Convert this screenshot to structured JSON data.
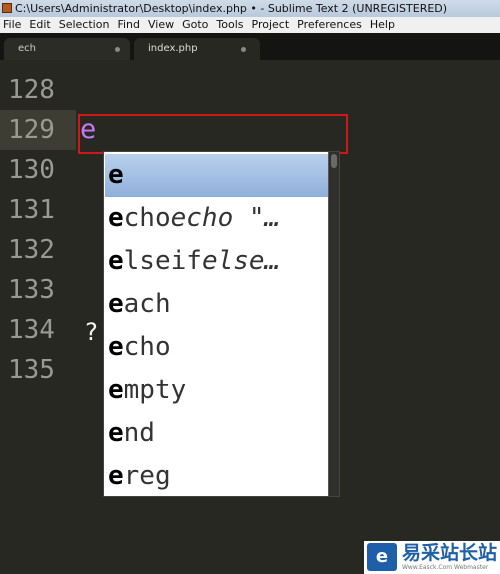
{
  "window": {
    "title": "C:\\Users\\Administrator\\Desktop\\index.php • - Sublime Text 2 (UNREGISTERED)"
  },
  "menu": [
    "File",
    "Edit",
    "Selection",
    "Find",
    "View",
    "Goto",
    "Tools",
    "Project",
    "Preferences",
    "Help"
  ],
  "tabs": [
    {
      "label": "ech",
      "active": false,
      "dirty": true
    },
    {
      "label": "index.php",
      "active": true,
      "dirty": true
    }
  ],
  "editor": {
    "line_numbers": [
      "128",
      "129",
      "130",
      "131",
      "132",
      "133",
      "134",
      "135"
    ],
    "current_line": "129",
    "typed_text": "e",
    "line_134_text": "?"
  },
  "autocomplete": {
    "prefix": "e",
    "items": [
      {
        "match": "e",
        "rest": "",
        "hint": ""
      },
      {
        "match": "e",
        "rest": "cho",
        "hint": "echo \"…"
      },
      {
        "match": "e",
        "rest": "lseif",
        "hint": "else…"
      },
      {
        "match": "e",
        "rest": "ach",
        "hint": ""
      },
      {
        "match": "e",
        "rest": "cho",
        "hint": ""
      },
      {
        "match": "e",
        "rest": "mpty",
        "hint": ""
      },
      {
        "match": "e",
        "rest": "nd",
        "hint": ""
      },
      {
        "match": "e",
        "rest": "reg",
        "hint": ""
      }
    ],
    "selected_index": 0
  },
  "watermark": {
    "text": "易采站长站",
    "subtitle": "Www.Easck.Com Webmaster",
    "logo_glyph": "e"
  }
}
